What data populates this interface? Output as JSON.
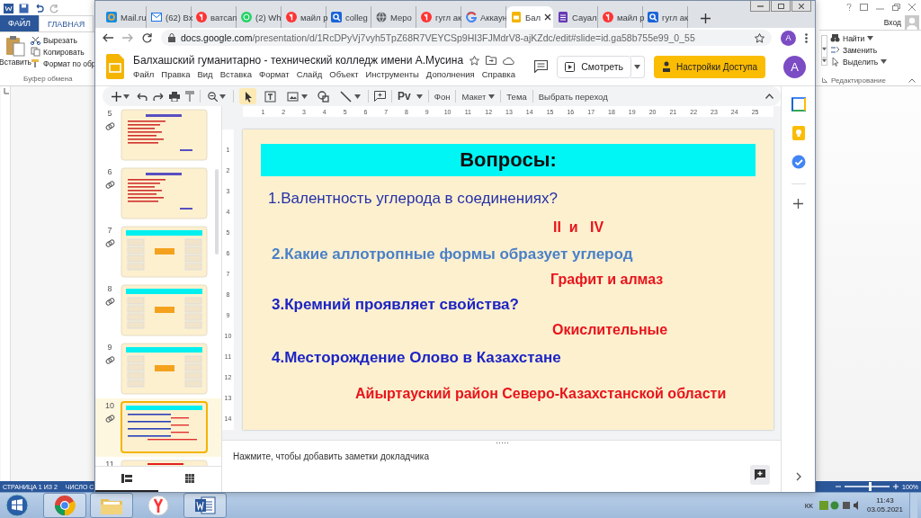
{
  "word": {
    "file_tab": "ФАЙЛ",
    "tabs": [
      {
        "label": "ГЛАВНАЯ",
        "selected": true
      }
    ],
    "clipboard": {
      "paste": "Вставить",
      "commands": [
        "Вырезать",
        "Копировать",
        "Формат по обр"
      ],
      "group": "Буфер обмена"
    },
    "editing": {
      "commands": [
        {
          "label": "Найти",
          "dropdown": true
        },
        {
          "label": "Заменить",
          "dropdown": false
        },
        {
          "label": "Выделить",
          "dropdown": true
        }
      ],
      "group": "Редактирование"
    },
    "account": "Вход",
    "status_bar": {
      "items": [
        "СТРАНИЦА 1 ИЗ 2",
        "ЧИСЛО С"
      ],
      "zoom": {
        "level": 0.55,
        "reading": "100%"
      }
    }
  },
  "browser": {
    "tabs": [
      {
        "title": "Mail.ru",
        "kind": "mailru",
        "selected": false
      },
      {
        "title": "(62) Вх",
        "kind": "envelope",
        "selected": false
      },
      {
        "title": "ватсап",
        "kind": "yandex",
        "selected": false
      },
      {
        "title": "(2) Wh",
        "kind": "chat",
        "selected": false
      },
      {
        "title": "майл р",
        "kind": "yandex",
        "selected": false
      },
      {
        "title": "colleg",
        "kind": "search",
        "selected": false
      },
      {
        "title": "Меро",
        "kind": "globe",
        "selected": false
      },
      {
        "title": "гугл ак",
        "kind": "yandex",
        "selected": false
      },
      {
        "title": "Аккаун",
        "kind": "google",
        "selected": false
      },
      {
        "title": "Бал",
        "kind": "slides",
        "selected": true
      },
      {
        "title": "Сауал",
        "kind": "form",
        "selected": false
      },
      {
        "title": "майл р",
        "kind": "yandex",
        "selected": false
      },
      {
        "title": "гугл ак",
        "kind": "search",
        "selected": false
      }
    ],
    "url": {
      "host": "docs.google.com",
      "path": "/presentation/d/1RcDPyVj7vyh5TpZ68R7VEYCSp9HI3FJMdrV8-ajKZdc/edit#slide=id.ga58b755e99_0_55"
    },
    "profile": "A"
  },
  "slides": {
    "title": "Балхашский гуманитарно - технический колледж имени А.Мусина",
    "menu": [
      "Файл",
      "Правка",
      "Вид",
      "Вставка",
      "Формат",
      "Слайд",
      "Объект",
      "Инструменты",
      "Дополнения",
      "Справка"
    ],
    "present": "Смотреть",
    "share": "Настройки Доступа",
    "avatar": "A",
    "toolbar": {
      "tools": [
        {
          "kind": "select",
          "selected": true
        },
        {
          "kind": "textbox",
          "selected": false
        },
        {
          "kind": "image",
          "selected": false
        },
        {
          "kind": "shape",
          "selected": false
        },
        {
          "kind": "line",
          "selected": false
        }
      ],
      "text_style": "Pv",
      "buttons": [
        {
          "label": "Фон",
          "dropdown": false
        },
        {
          "label": "Макет",
          "dropdown": true
        },
        {
          "label": "Тема",
          "dropdown": false
        },
        {
          "label": "Выбрать переход",
          "dropdown": false
        }
      ]
    },
    "thumbnails": [
      {
        "number": "5",
        "kind": "text",
        "selected": false
      },
      {
        "number": "6",
        "kind": "text",
        "selected": false
      },
      {
        "number": "7",
        "kind": "diagram",
        "selected": false
      },
      {
        "number": "8",
        "kind": "diagram",
        "selected": false
      },
      {
        "number": "9",
        "kind": "diagram",
        "selected": false
      },
      {
        "number": "10",
        "kind": "questions",
        "selected": true
      },
      {
        "number": "11",
        "kind": "title",
        "selected": false
      }
    ],
    "views": [
      {
        "kind": "list",
        "selected": true
      },
      {
        "kind": "grid",
        "selected": false
      }
    ],
    "rulers": {
      "horizontal": [
        "1",
        "2",
        "3",
        "4",
        "5",
        "6",
        "7",
        "8",
        "9",
        "10",
        "11",
        "12",
        "13",
        "14",
        "15",
        "16",
        "17",
        "18",
        "19",
        "20",
        "21",
        "22",
        "23",
        "24",
        "25"
      ],
      "vertical": [
        "1",
        "2",
        "3",
        "4",
        "5",
        "6",
        "7",
        "8",
        "9",
        "10",
        "11",
        "12",
        "13",
        "14"
      ]
    },
    "slide": {
      "heading": "Вопросы:",
      "lines": [
        {
          "text": "1.Валентность углерода в соединениях?",
          "kind": "question",
          "color": "#2430a8",
          "bold": false
        },
        {
          "text": "II  и   IV",
          "kind": "answer",
          "color": "#e8141c",
          "bold": true
        },
        {
          "text": "2.Какие аллотропные формы образует углерод",
          "kind": "question",
          "color": "#4a80c8",
          "bold": true
        },
        {
          "text": "Графит и алмаз",
          "kind": "answer",
          "color": "#e8141c",
          "bold": true
        },
        {
          "text": "3.Кремний проявляет свойства?",
          "kind": "question",
          "color": "#1c24c4",
          "bold": true
        },
        {
          "text": "Окислительные",
          "kind": "answer",
          "color": "#e8141c",
          "bold": true
        },
        {
          "text": "4.Месторождение Олово в Казахстане",
          "kind": "question",
          "color": "#1c24c4",
          "bold": true
        },
        {
          "text": "Айыртауский район Северо-Казахстанской области",
          "kind": "answer",
          "color": "#e8141c",
          "bold": true
        }
      ]
    },
    "notes": "Нажмите, чтобы добавить заметки докладчика"
  },
  "taskbar": {
    "apps": [
      {
        "kind": "chrome",
        "open": true
      },
      {
        "kind": "explorer",
        "open": true
      },
      {
        "kind": "yandex",
        "open": false
      },
      {
        "kind": "word",
        "open": true
      }
    ],
    "language": "КК",
    "time": "11:43",
    "date": "03.05.2021"
  }
}
